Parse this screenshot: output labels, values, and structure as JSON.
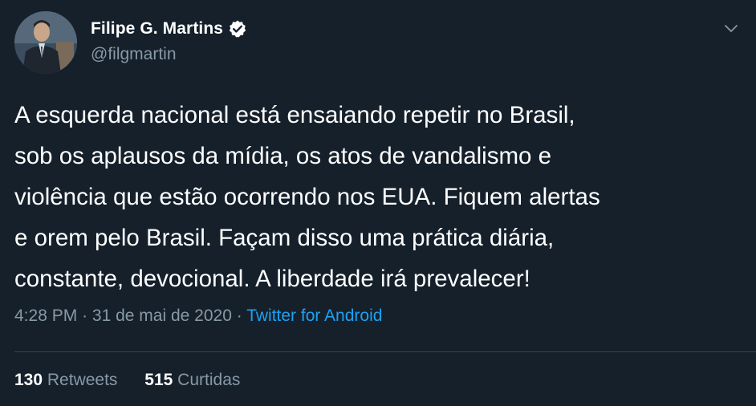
{
  "author": {
    "display_name": "Filipe G. Martins",
    "handle": "@filgmartin",
    "verified_icon": "verified-badge-icon"
  },
  "tweet": {
    "lines": [
      "A esquerda nacional está ensaiando repetir no Brasil,",
      "sob os aplausos da mídia, os atos de vandalismo e",
      "violência que estão ocorrendo nos EUA. Fiquem alertas",
      "e orem pelo Brasil. Façam disso uma prática diária,",
      "constante, devocional. A liberdade irá prevalecer!"
    ],
    "time": "4:28 PM",
    "separator": "·",
    "date": "31 de mai de 2020",
    "source": "Twitter for Android"
  },
  "stats": {
    "retweets_count": "130",
    "retweets_label": "Retweets",
    "likes_count": "515",
    "likes_label": "Curtidas"
  },
  "colors": {
    "background": "#15202b",
    "text": "#ffffff",
    "secondary": "#8899a6",
    "accent": "#1da1f2",
    "divider": "#38444d"
  }
}
